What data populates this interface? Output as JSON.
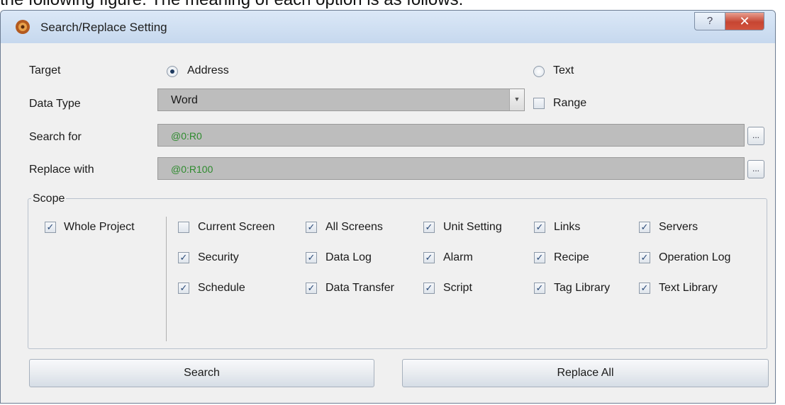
{
  "doc_text": "the following figure. The meaning of each option is as follows:",
  "window": {
    "title": "Search/Replace Setting",
    "help_glyph": "?",
    "close_glyph": "✕"
  },
  "icons": {
    "app": "app-icon",
    "help": "help-icon",
    "close": "close-icon",
    "dropdown": "chevron-down-icon",
    "browse": "ellipsis-icon"
  },
  "target": {
    "label": "Target",
    "options": [
      {
        "label": "Address",
        "selected": true
      },
      {
        "label": "Text",
        "selected": false
      }
    ]
  },
  "data_type": {
    "label": "Data Type",
    "value": "Word",
    "range_label": "Range",
    "range_checked": false
  },
  "search_for": {
    "label": "Search for",
    "value": "@0:R0",
    "browse": "..."
  },
  "replace_with": {
    "label": "Replace with",
    "value": "@0:R100",
    "browse": "..."
  },
  "scope": {
    "label": "Scope",
    "whole_project": {
      "label": "Whole Project",
      "checked": true
    },
    "items": [
      {
        "label": "Current Screen",
        "checked": false
      },
      {
        "label": "All Screens",
        "checked": true
      },
      {
        "label": "Unit Setting",
        "checked": true
      },
      {
        "label": "Links",
        "checked": true
      },
      {
        "label": "Servers",
        "checked": true
      },
      {
        "label": "Security",
        "checked": true
      },
      {
        "label": "Data Log",
        "checked": true
      },
      {
        "label": "Alarm",
        "checked": true
      },
      {
        "label": "Recipe",
        "checked": true
      },
      {
        "label": "Operation Log",
        "checked": true
      },
      {
        "label": "Schedule",
        "checked": true
      },
      {
        "label": "Data Transfer",
        "checked": true
      },
      {
        "label": "Script",
        "checked": true
      },
      {
        "label": "Tag Library",
        "checked": true
      },
      {
        "label": "Text Library",
        "checked": true
      }
    ]
  },
  "buttons": {
    "search": "Search",
    "replace_all": "Replace All"
  },
  "colors": {
    "field_bg": "#bdbdbd",
    "address_text": "#2e8b2e",
    "close_red": "#c64532"
  }
}
